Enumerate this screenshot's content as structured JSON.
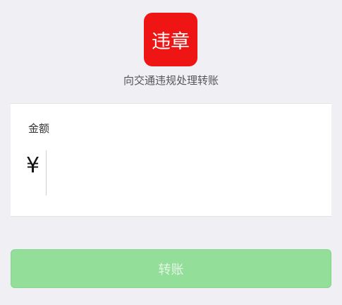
{
  "payee": {
    "logo_text": "违章",
    "name": "向交通违规处理转账"
  },
  "amount_card": {
    "label": "金额",
    "currency_symbol": "¥",
    "input_value": ""
  },
  "actions": {
    "transfer_label": "转账"
  },
  "colors": {
    "background": "#efeff4",
    "logo_red": "#f01515",
    "button_green_disabled": "#93df9a"
  }
}
